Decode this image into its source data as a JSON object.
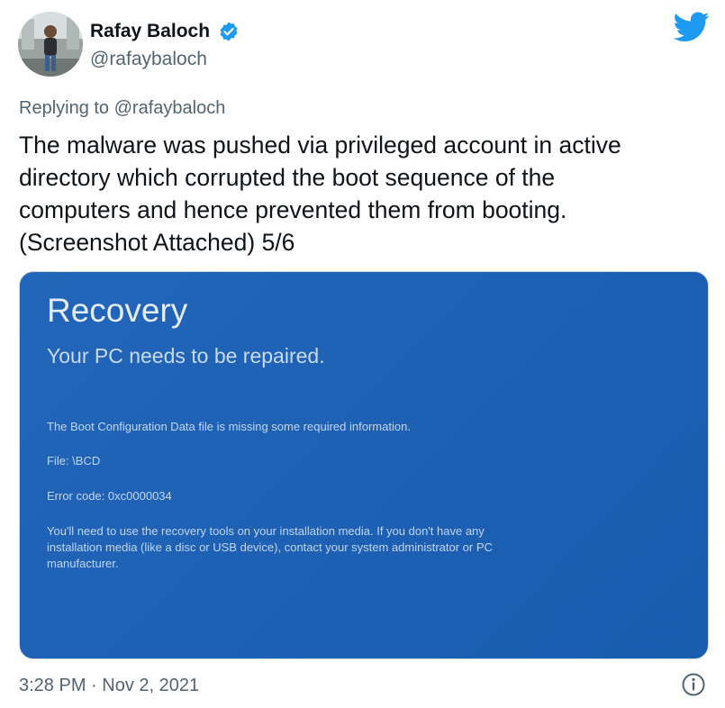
{
  "author": {
    "name": "Rafay Baloch",
    "handle": "@rafaybaloch",
    "avatar_icon": "profile-photo",
    "verified_icon": "verified-badge-icon",
    "verified_color": "#1d9bf0"
  },
  "platform": {
    "icon": "twitter-bird-icon",
    "color": "#1d9bf0"
  },
  "tweet": {
    "replying_to": "Replying to @rafaybaloch",
    "text_lines": [
      "The malware was pushed via privileged account in active",
      "directory which corrupted the boot sequence of the",
      "computers and hence prevented them from booting.",
      "(Screenshot Attached) 5/6"
    ],
    "timestamp": "3:28 PM · Nov 2, 2021",
    "info_icon": "info-icon"
  },
  "media": {
    "background_color": "#1f63b8",
    "title": "Recovery",
    "subtitle": "Your PC needs to be repaired.",
    "lines": [
      "The Boot Configuration Data file is missing some required information.",
      "File: \\BCD",
      "Error code: 0xc0000034",
      "You'll need to use the recovery tools on your installation media. If you don't have any",
      "installation media (like a disc or USB device), contact your system administrator or PC",
      "manufacturer."
    ]
  }
}
